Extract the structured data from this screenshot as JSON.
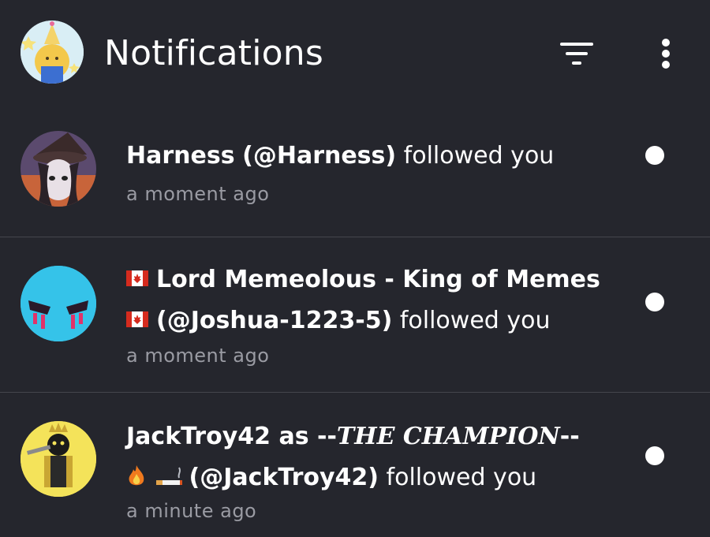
{
  "header": {
    "title": "Notifications",
    "filter_icon": "filter-icon",
    "more_icon": "more-vertical-icon"
  },
  "notifications": [
    {
      "name": "Harness",
      "handle": "(@Harness)",
      "action": "followed you",
      "time": "a moment ago",
      "unread": true
    },
    {
      "name_line1": "Lord Memeolous - King of Memes",
      "handle": "(@Joshua-1223-5)",
      "action": "followed you",
      "time": "a moment ago",
      "flag_icon": "canada-flag-icon",
      "unread": true
    },
    {
      "name_prefix": "JackTroy42 as --",
      "name_styled": "THE CHAMPION",
      "name_suffix": "--",
      "handle": "(@JackTroy42)",
      "action": "followed you",
      "time": "a minute ago",
      "emoji_icons": [
        "fire-icon",
        "cigarette-icon"
      ],
      "unread": true
    }
  ],
  "colors": {
    "background": "#25262d",
    "divider": "#45464d",
    "muted_text": "#9a9ba3",
    "unread_dot": "#ffffff"
  }
}
